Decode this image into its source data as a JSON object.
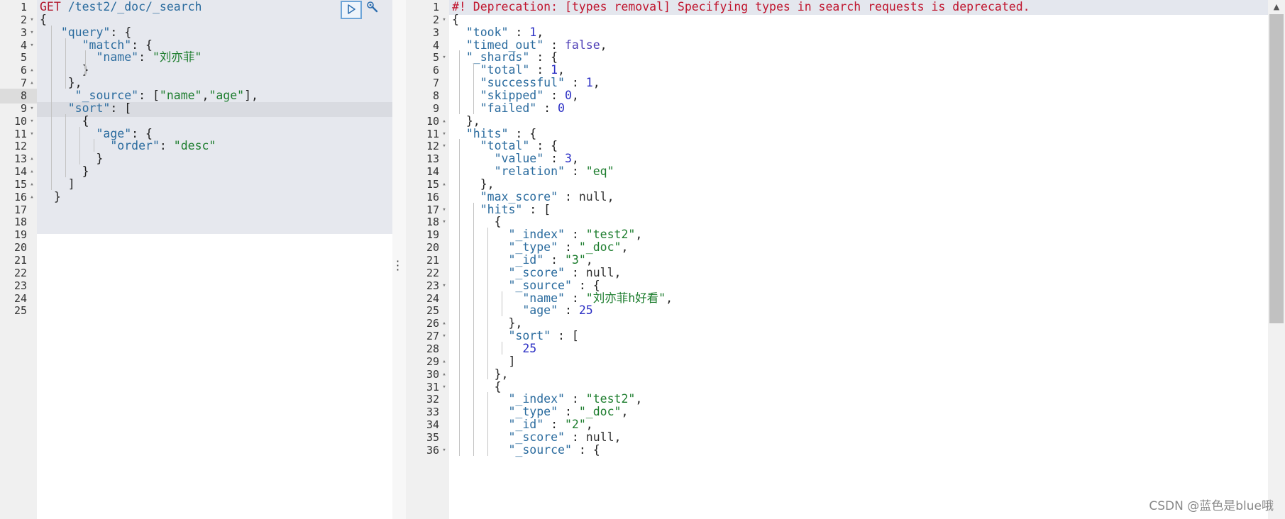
{
  "request": {
    "line_numbers": [
      "1",
      "2",
      "3",
      "4",
      "5",
      "6",
      "7",
      "8",
      "9",
      "10",
      "11",
      "12",
      "13",
      "14",
      "15",
      "16",
      "17",
      "18",
      "19",
      "20",
      "21",
      "22",
      "23",
      "24",
      "25"
    ],
    "active_line": 8,
    "verb": "GET",
    "url": " /test2/_doc/_search",
    "lines": [
      [
        {
          "t": "verb",
          "v": "GET"
        },
        {
          "t": "url",
          "v": " /test2/_doc/_search"
        }
      ],
      [
        {
          "t": "p",
          "v": "{"
        }
      ],
      [
        {
          "t": "p",
          "v": "   "
        },
        {
          "t": "key",
          "v": "\"query\""
        },
        {
          "t": "p",
          "v": ": {"
        }
      ],
      [
        {
          "t": "p",
          "v": "      "
        },
        {
          "t": "key",
          "v": "\"match\""
        },
        {
          "t": "p",
          "v": ": {"
        }
      ],
      [
        {
          "t": "p",
          "v": "        "
        },
        {
          "t": "key",
          "v": "\"name\""
        },
        {
          "t": "p",
          "v": ": "
        },
        {
          "t": "str",
          "v": "\"刘亦菲\""
        }
      ],
      [
        {
          "t": "p",
          "v": "      }"
        }
      ],
      [
        {
          "t": "p",
          "v": "    },"
        }
      ],
      [
        {
          "t": "p",
          "v": "     "
        },
        {
          "t": "key",
          "v": "\"_source\""
        },
        {
          "t": "p",
          "v": ": ["
        },
        {
          "t": "str",
          "v": "\"name\""
        },
        {
          "t": "p",
          "v": ","
        },
        {
          "t": "str",
          "v": "\"age\""
        },
        {
          "t": "p",
          "v": "],"
        }
      ],
      [
        {
          "t": "p",
          "v": "    "
        },
        {
          "t": "key",
          "v": "\"sort\""
        },
        {
          "t": "p",
          "v": ": ["
        }
      ],
      [
        {
          "t": "p",
          "v": "      {"
        }
      ],
      [
        {
          "t": "p",
          "v": "        "
        },
        {
          "t": "key",
          "v": "\"age\""
        },
        {
          "t": "p",
          "v": ": {"
        }
      ],
      [
        {
          "t": "p",
          "v": "          "
        },
        {
          "t": "key",
          "v": "\"order\""
        },
        {
          "t": "p",
          "v": ": "
        },
        {
          "t": "str",
          "v": "\"desc\""
        }
      ],
      [
        {
          "t": "p",
          "v": "        }"
        }
      ],
      [
        {
          "t": "p",
          "v": "      }"
        }
      ],
      [
        {
          "t": "p",
          "v": "    ]"
        }
      ],
      [
        {
          "t": "p",
          "v": "  }"
        }
      ]
    ],
    "fold_marks": {
      "2": "▾",
      "3": "▾",
      "4": "▾",
      "6": "▴",
      "7": "▴",
      "9": "▾",
      "10": "▾",
      "11": "▾",
      "13": "▴",
      "14": "▴",
      "15": "▴",
      "16": "▴"
    }
  },
  "toolbar": {
    "run_icon": "play-icon",
    "settings_icon": "wrench-icon"
  },
  "response": {
    "line_numbers": [
      "1",
      "2",
      "3",
      "4",
      "5",
      "6",
      "7",
      "8",
      "9",
      "10",
      "11",
      "12",
      "13",
      "14",
      "15",
      "16",
      "17",
      "18",
      "19",
      "20",
      "21",
      "22",
      "23",
      "24",
      "25",
      "26",
      "27",
      "28",
      "29",
      "30",
      "31",
      "32",
      "33",
      "34",
      "35",
      "36"
    ],
    "lines": [
      [
        {
          "t": "warn",
          "v": "#! Deprecation: [types removal] Specifying types in search requests is deprecated."
        }
      ],
      [
        {
          "t": "p",
          "v": "{"
        }
      ],
      [
        {
          "t": "p",
          "v": "  "
        },
        {
          "t": "key",
          "v": "\"took\""
        },
        {
          "t": "p",
          "v": " : "
        },
        {
          "t": "num",
          "v": "1"
        },
        {
          "t": "p",
          "v": ","
        }
      ],
      [
        {
          "t": "p",
          "v": "  "
        },
        {
          "t": "key",
          "v": "\"timed_out\""
        },
        {
          "t": "p",
          "v": " : "
        },
        {
          "t": "kw",
          "v": "false"
        },
        {
          "t": "p",
          "v": ","
        }
      ],
      [
        {
          "t": "p",
          "v": "  "
        },
        {
          "t": "key",
          "v": "\"_shards\""
        },
        {
          "t": "p",
          "v": " : {"
        }
      ],
      [
        {
          "t": "p",
          "v": "    "
        },
        {
          "t": "key",
          "v": "\"total\""
        },
        {
          "t": "p",
          "v": " : "
        },
        {
          "t": "num",
          "v": "1"
        },
        {
          "t": "p",
          "v": ","
        }
      ],
      [
        {
          "t": "p",
          "v": "    "
        },
        {
          "t": "key",
          "v": "\"successful\""
        },
        {
          "t": "p",
          "v": " : "
        },
        {
          "t": "num",
          "v": "1"
        },
        {
          "t": "p",
          "v": ","
        }
      ],
      [
        {
          "t": "p",
          "v": "    "
        },
        {
          "t": "key",
          "v": "\"skipped\""
        },
        {
          "t": "p",
          "v": " : "
        },
        {
          "t": "num",
          "v": "0"
        },
        {
          "t": "p",
          "v": ","
        }
      ],
      [
        {
          "t": "p",
          "v": "    "
        },
        {
          "t": "key",
          "v": "\"failed\""
        },
        {
          "t": "p",
          "v": " : "
        },
        {
          "t": "num",
          "v": "0"
        }
      ],
      [
        {
          "t": "p",
          "v": "  },"
        }
      ],
      [
        {
          "t": "p",
          "v": "  "
        },
        {
          "t": "key",
          "v": "\"hits\""
        },
        {
          "t": "p",
          "v": " : {"
        }
      ],
      [
        {
          "t": "p",
          "v": "    "
        },
        {
          "t": "key",
          "v": "\"total\""
        },
        {
          "t": "p",
          "v": " : {"
        }
      ],
      [
        {
          "t": "p",
          "v": "      "
        },
        {
          "t": "key",
          "v": "\"value\""
        },
        {
          "t": "p",
          "v": " : "
        },
        {
          "t": "num",
          "v": "3"
        },
        {
          "t": "p",
          "v": ","
        }
      ],
      [
        {
          "t": "p",
          "v": "      "
        },
        {
          "t": "key",
          "v": "\"relation\""
        },
        {
          "t": "p",
          "v": " : "
        },
        {
          "t": "str",
          "v": "\"eq\""
        }
      ],
      [
        {
          "t": "p",
          "v": "    },"
        }
      ],
      [
        {
          "t": "p",
          "v": "    "
        },
        {
          "t": "key",
          "v": "\"max_score\""
        },
        {
          "t": "p",
          "v": " : "
        },
        {
          "t": "null",
          "v": "null"
        },
        {
          "t": "p",
          "v": ","
        }
      ],
      [
        {
          "t": "p",
          "v": "    "
        },
        {
          "t": "key",
          "v": "\"hits\""
        },
        {
          "t": "p",
          "v": " : ["
        }
      ],
      [
        {
          "t": "p",
          "v": "      {"
        }
      ],
      [
        {
          "t": "p",
          "v": "        "
        },
        {
          "t": "key",
          "v": "\"_index\""
        },
        {
          "t": "p",
          "v": " : "
        },
        {
          "t": "str",
          "v": "\"test2\""
        },
        {
          "t": "p",
          "v": ","
        }
      ],
      [
        {
          "t": "p",
          "v": "        "
        },
        {
          "t": "key",
          "v": "\"_type\""
        },
        {
          "t": "p",
          "v": " : "
        },
        {
          "t": "str",
          "v": "\"_doc\""
        },
        {
          "t": "p",
          "v": ","
        }
      ],
      [
        {
          "t": "p",
          "v": "        "
        },
        {
          "t": "key",
          "v": "\"_id\""
        },
        {
          "t": "p",
          "v": " : "
        },
        {
          "t": "str",
          "v": "\"3\""
        },
        {
          "t": "p",
          "v": ","
        }
      ],
      [
        {
          "t": "p",
          "v": "        "
        },
        {
          "t": "key",
          "v": "\"_score\""
        },
        {
          "t": "p",
          "v": " : "
        },
        {
          "t": "null",
          "v": "null"
        },
        {
          "t": "p",
          "v": ","
        }
      ],
      [
        {
          "t": "p",
          "v": "        "
        },
        {
          "t": "key",
          "v": "\"_source\""
        },
        {
          "t": "p",
          "v": " : {"
        }
      ],
      [
        {
          "t": "p",
          "v": "          "
        },
        {
          "t": "key",
          "v": "\"name\""
        },
        {
          "t": "p",
          "v": " : "
        },
        {
          "t": "str",
          "v": "\"刘亦菲h好看\""
        },
        {
          "t": "p",
          "v": ","
        }
      ],
      [
        {
          "t": "p",
          "v": "          "
        },
        {
          "t": "key",
          "v": "\"age\""
        },
        {
          "t": "p",
          "v": " : "
        },
        {
          "t": "num",
          "v": "25"
        }
      ],
      [
        {
          "t": "p",
          "v": "        },"
        }
      ],
      [
        {
          "t": "p",
          "v": "        "
        },
        {
          "t": "key",
          "v": "\"sort\""
        },
        {
          "t": "p",
          "v": " : ["
        }
      ],
      [
        {
          "t": "p",
          "v": "          "
        },
        {
          "t": "num",
          "v": "25"
        }
      ],
      [
        {
          "t": "p",
          "v": "        ]"
        }
      ],
      [
        {
          "t": "p",
          "v": "      },"
        }
      ],
      [
        {
          "t": "p",
          "v": "      {"
        }
      ],
      [
        {
          "t": "p",
          "v": "        "
        },
        {
          "t": "key",
          "v": "\"_index\""
        },
        {
          "t": "p",
          "v": " : "
        },
        {
          "t": "str",
          "v": "\"test2\""
        },
        {
          "t": "p",
          "v": ","
        }
      ],
      [
        {
          "t": "p",
          "v": "        "
        },
        {
          "t": "key",
          "v": "\"_type\""
        },
        {
          "t": "p",
          "v": " : "
        },
        {
          "t": "str",
          "v": "\"_doc\""
        },
        {
          "t": "p",
          "v": ","
        }
      ],
      [
        {
          "t": "p",
          "v": "        "
        },
        {
          "t": "key",
          "v": "\"_id\""
        },
        {
          "t": "p",
          "v": " : "
        },
        {
          "t": "str",
          "v": "\"2\""
        },
        {
          "t": "p",
          "v": ","
        }
      ],
      [
        {
          "t": "p",
          "v": "        "
        },
        {
          "t": "key",
          "v": "\"_score\""
        },
        {
          "t": "p",
          "v": " : "
        },
        {
          "t": "null",
          "v": "null"
        },
        {
          "t": "p",
          "v": ","
        }
      ],
      [
        {
          "t": "p",
          "v": "        "
        },
        {
          "t": "key",
          "v": "\"_source\""
        },
        {
          "t": "p",
          "v": " : {"
        }
      ]
    ],
    "fold_marks": {
      "2": "▾",
      "5": "▾",
      "10": "▴",
      "11": "▾",
      "12": "▾",
      "15": "▴",
      "17": "▾",
      "18": "▾",
      "23": "▾",
      "26": "▴",
      "27": "▾",
      "29": "▴",
      "30": "▴",
      "31": "▾",
      "36": "▾"
    }
  },
  "watermark": "CSDN @蓝色是blue哦",
  "colors": {
    "key": "#2a6b9e",
    "string": "#1d7d2e",
    "number": "#2b2fc4",
    "warning": "#c0152e",
    "verb": "#b21a2f"
  }
}
